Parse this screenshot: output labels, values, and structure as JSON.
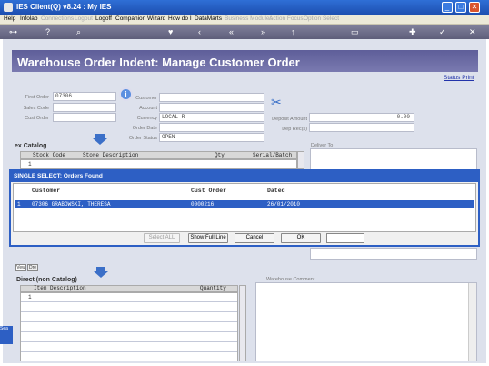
{
  "window": {
    "title": "IES Client(Q) v8.24 : My IES",
    "minimize": "_",
    "maximize": "□",
    "close": "✕"
  },
  "menu": [
    "Help",
    "Infolab",
    "Connections",
    "Logout",
    "Logoff",
    "Companion",
    "Wizard",
    "How do I",
    "DataMarts",
    "Business Modules",
    "Action Focus",
    "Option Select"
  ],
  "menu_disabled": [
    false,
    false,
    true,
    true,
    false,
    false,
    false,
    false,
    false,
    true,
    true,
    true
  ],
  "toolbar_icons": [
    "key-icon",
    "help-icon",
    "search-icon",
    "heart-icon",
    "back-icon",
    "back-fast-icon",
    "forward-icon",
    "forward-fast-icon",
    "up-icon",
    "print-icon",
    "plus-icon",
    "check-icon",
    "close-icon"
  ],
  "page": {
    "title": "Warehouse Order Indent: Manage Customer Order",
    "status_print": "Status Print"
  },
  "form": {
    "first_order_label": "First Order",
    "first_order_value": "07306",
    "sales_code_label": "Sales Code",
    "sales_code_value": "",
    "cust_order_label": "Cust Order",
    "cust_order_value": "",
    "customer_label": "Customer",
    "customer_value": "",
    "account_label": "Account",
    "account_value": "",
    "currency_label": "Currency",
    "currency_value": "LOCAL R",
    "order_date_label": "Order Date",
    "order_date_value": "",
    "order_status_label": "Order Status",
    "order_status_value": "OPEN",
    "deposit_label": "Deposit Amount",
    "deposit_value": "0.00",
    "dep_receipt_label": "Dep Rec(s)",
    "dep_receipt_value": "",
    "deliver_to_label": "Deliver To",
    "warehouse_comment_label": "Warehouse Comment"
  },
  "catalog": {
    "title": "ex Catalog",
    "columns": [
      "Stock Code",
      "Store Description",
      "Qty",
      "Serial/Batch"
    ],
    "first_row_num": "1"
  },
  "tabs": [
    "Vew",
    "Dre"
  ],
  "direct": {
    "title": "Direct (non Catalog)",
    "columns": [
      "Item Description",
      "Quantity"
    ],
    "first_row_num": "1"
  },
  "dialog": {
    "title": "SINGLE SELECT: Orders Found",
    "columns": [
      "Customer",
      "Cust Order",
      "Dated"
    ],
    "rows": [
      {
        "num": "1",
        "customer": "07306 GRABOWSKI, THERESA",
        "cust_order": "0000216",
        "dated": "26/01/2010"
      }
    ],
    "buttons": {
      "select_all": "Select ALL",
      "show_full_line": "Show Full Line",
      "cancel": "Cancel",
      "ok": "OK"
    },
    "search_value": ""
  },
  "side": {
    "label": "Sea"
  }
}
